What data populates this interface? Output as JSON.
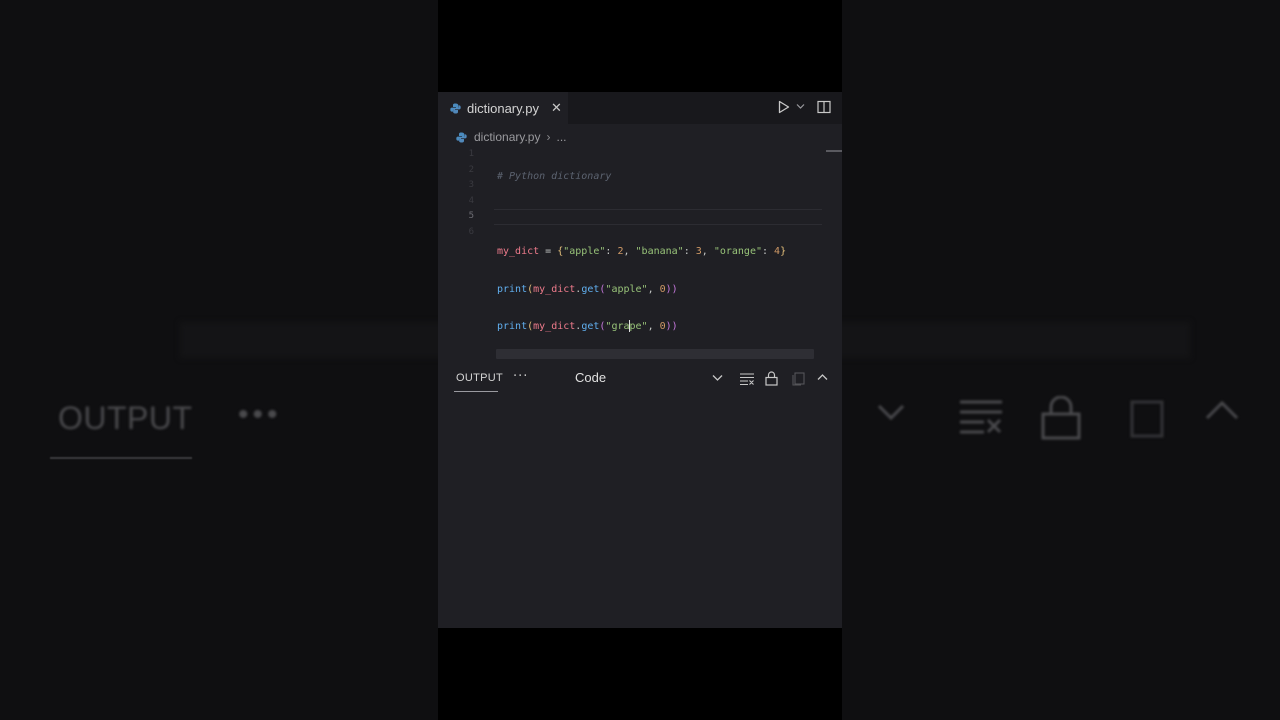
{
  "editor": {
    "tab_label": "dictionary.py",
    "tab_close": "✕",
    "breadcrumb_file": "dictionary.py",
    "breadcrumb_sep": "›",
    "breadcrumb_more": "...",
    "line_numbers": [
      "1",
      "2",
      "3",
      "4",
      "5",
      "6"
    ],
    "active_line": 5,
    "code": {
      "line1_comment": "# Python dictionary",
      "line3": {
        "var": "my_dict",
        "assign": " = ",
        "open": "{",
        "k1": "\"apple\"",
        "c1": ": ",
        "v1": "2",
        "s1": ", ",
        "k2": "\"banana\"",
        "c2": ": ",
        "v2": "3",
        "s2": ", ",
        "k3": "\"orange\"",
        "c3": ": ",
        "v3": "4",
        "close": "}"
      },
      "line4": {
        "fn": "print",
        "open": "(",
        "var": "my_dict",
        "dot": ".",
        "method": "get",
        "open2": "(",
        "arg": "\"apple\"",
        "sep": ", ",
        "default": "0",
        "close": "))"
      },
      "line5": {
        "fn": "print",
        "open": "(",
        "var": "my_dict",
        "dot": ".",
        "method": "get",
        "open2": "(",
        "arg_before_cursor": "\"gra",
        "arg_after_cursor": "pe\"",
        "sep": ", ",
        "default": "0",
        "close": "))"
      }
    }
  },
  "panel": {
    "tab_label": "OUTPUT",
    "more_label": "···",
    "select_value": "Code"
  },
  "background": {
    "output_label": "OUTPUT",
    "dots": "•••"
  },
  "icons": {
    "python": "python-file-icon",
    "run": "run-icon",
    "split": "split-editor-icon",
    "clear": "clear-output-icon",
    "lock": "lock-icon",
    "copy": "copy-icon",
    "collapse": "chevron-up-icon"
  },
  "colors": {
    "editor_bg": "#1f1f24",
    "variable": "#ef7b8c",
    "string": "#98c379",
    "number": "#d19a66",
    "function": "#61afef"
  }
}
